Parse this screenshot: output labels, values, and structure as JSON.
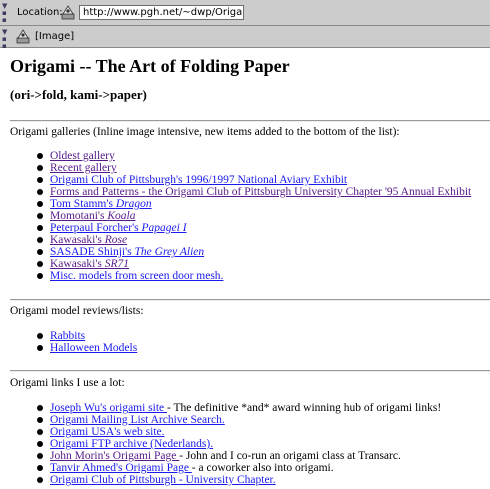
{
  "toolbar": {
    "location_label": "Location:",
    "url": "http://www.pgh.net/~dwp/Origami.html",
    "image_label": "[Image]"
  },
  "page": {
    "title": "Origami -- The Art of Folding Paper",
    "subtitle": "(ori->fold, kami->paper)"
  },
  "galleries": {
    "heading": "Origami galleries (Inline image intensive, new items added to the bottom of the list):",
    "items": [
      {
        "link": "Oldest gallery ",
        "link_italic": "",
        "text": ""
      },
      {
        "link": "Recent gallery ",
        "link_italic": "",
        "text": ""
      },
      {
        "link": "Origami Club of Pittsburgh's 1996/1997 National Aviary Exhibit",
        "link_italic": "",
        "text": ""
      },
      {
        "link": "Forms and Patterns - the Origami Club of Pittsburgh University Chapter '95 Annual Exhibit",
        "link_italic": "",
        "text": ""
      },
      {
        "link": "Tom Stamm's ",
        "link_italic": "Dragon",
        "text": ""
      },
      {
        "link": "Momotani's ",
        "link_italic": "Koala",
        "text": ""
      },
      {
        "link": "Peterpaul Forcher's ",
        "link_italic": "Papagei I",
        "text": ""
      },
      {
        "link": "Kawasaki's ",
        "link_italic": "Rose",
        "text": ""
      },
      {
        "link": "SASADE Shinji's ",
        "link_italic": "The Grey Alien",
        "text": ""
      },
      {
        "link": "Kawasaki's ",
        "link_italic": "SR71",
        "text": ""
      },
      {
        "link": "Misc. models from screen door mesh.",
        "link_italic": "",
        "text": ""
      }
    ]
  },
  "reviews": {
    "heading": "Origami model reviews/lists:",
    "items": [
      {
        "link": "Rabbits ",
        "link_italic": "",
        "text": ""
      },
      {
        "link": "Halloween Models ",
        "link_italic": "",
        "text": ""
      }
    ]
  },
  "links": {
    "heading": "Origami links I use a lot:",
    "items": [
      {
        "link": "Joseph Wu's origami site ",
        "link_italic": "",
        "text": " - The definitive *and* award winning hub of origami links!"
      },
      {
        "link": "Origami Mailing List Archive Search.",
        "link_italic": "",
        "text": ""
      },
      {
        "link": "Origami USA's web site.",
        "link_italic": "",
        "text": ""
      },
      {
        "link": "Origami FTP archive (Nederlands).",
        "link_italic": "",
        "text": ""
      },
      {
        "link": "John Morin's Origami Page ",
        "link_italic": "",
        "text": " - John and I co-run an origami class at Transarc."
      },
      {
        "link": "Tanvir Ahmed's Origami Page ",
        "link_italic": "",
        "text": " - a coworker also into origami."
      },
      {
        "link": "Origami Club of Pittsburgh - University Chapter.",
        "link_italic": "",
        "text": ""
      }
    ]
  },
  "colors": {
    "link": "#1a1aee",
    "visited_link": "#551a8b",
    "toolbar_bg": "#cccccc"
  },
  "icons": {
    "location": "netscape-page-icon",
    "image": "netscape-page-icon"
  }
}
